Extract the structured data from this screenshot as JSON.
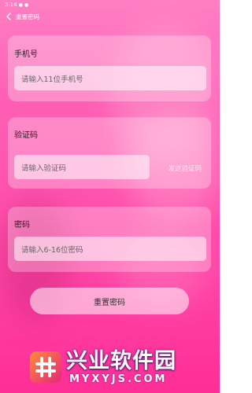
{
  "status_bar": {
    "time": "3:14"
  },
  "nav": {
    "title": "重置密码"
  },
  "phone": {
    "label": "手机号",
    "placeholder": "请输入11位手机号"
  },
  "code": {
    "label": "验证码",
    "placeholder": "请输入验证码",
    "send_label": "发送验证码"
  },
  "password": {
    "label": "密码",
    "placeholder": "请输入6-16位密码"
  },
  "submit": {
    "label": "重置密码"
  },
  "watermark": {
    "title": "兴业软件园",
    "subtitle": "MYXYJS.COM"
  },
  "colors": {
    "accent": "#ff4fac",
    "gradient_top": "#ff7fc3",
    "gradient_bottom": "#ff2e97"
  }
}
